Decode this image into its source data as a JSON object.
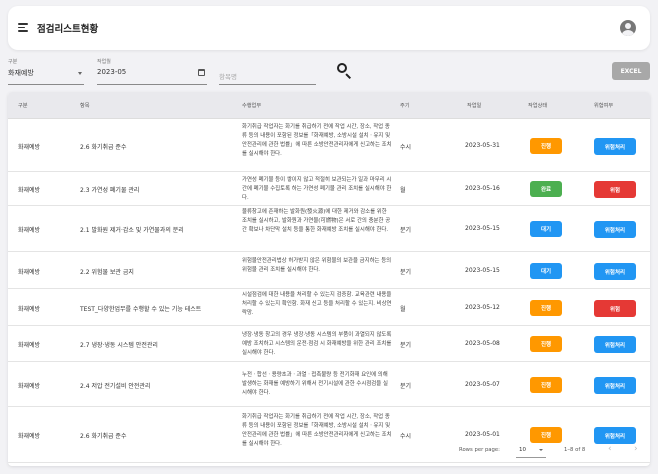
{
  "app": {
    "title": "점검리스트현황"
  },
  "colors": {
    "orange": "#ff9800",
    "green": "#4caf50",
    "blue": "#2196f3",
    "red": "#e53935"
  },
  "filters": {
    "category": {
      "label": "구분",
      "value": "화재예방"
    },
    "date": {
      "label": "작업월",
      "value": "2023-05"
    },
    "item": {
      "placeholder": "항목명"
    },
    "excel_label": "EXCEL"
  },
  "table": {
    "headers": [
      "구분",
      "항목",
      "수행업무",
      "주기",
      "작업일",
      "작업상태",
      "위험여부"
    ],
    "rows": [
      {
        "category": "화재예방",
        "item": "2.6 화기취급 준수",
        "desc": "화기취급 작업자는 화기를 취급하기 전에 작업 시간, 장소, 작업 종류 등의 내용이 포함된 정보를「화재예방, 소방시설 설치ㆍ유지 및 안전관리에 관한 법률」에 따른 소방안전관리자에게 신고하는 조치를 실시해야 한다.",
        "cycle": "수시",
        "date": "2023-05-31",
        "status": "진행",
        "status_color": "orange",
        "risk": "위험처리",
        "risk_color": "blue"
      },
      {
        "category": "화재예방",
        "item": "2.3 가연성 폐기물 관리",
        "desc": "가연성 폐기물 등이 쌓이지 않고 적절히 보관되는가 일과 마무리 시간에 폐기물 수집토록 하는 가연성 폐기물 관리 조치를 실시해야 한다.",
        "cycle": "월",
        "date": "2023-05-16",
        "status": "완료",
        "status_color": "green",
        "risk": "위험",
        "risk_color": "red"
      },
      {
        "category": "화재예방",
        "item": "2.1 발화원 제거·감소 및 가연물과의 분리",
        "desc": "물류창고에 존재하는 발화원(發火源)에 대한 제거와 감소를 위한 조치를 실시하고, 발화원과 가연물(可燃物)은 서로 간의 충분한 공간 확보나 차단막 설치 등을 통한 화재예방 조치를 실시해야 한다.",
        "cycle": "분기",
        "date": "2023-05-15",
        "status": "대기",
        "status_color": "blue",
        "risk": "위험처리",
        "risk_color": "blue"
      },
      {
        "category": "화재예방",
        "item": "2.2 위험물 보관 금지",
        "desc": "위험물안전관리법상 허가받지 않은 위험물의 보관을 금지하는 등의 위험물 관리 조치를 실시해야 한다.",
        "cycle": "분기",
        "date": "2023-05-15",
        "status": "대기",
        "status_color": "blue",
        "risk": "위험처리",
        "risk_color": "blue"
      },
      {
        "category": "화재예방",
        "item": "TEST_다양한업무를 수행할 수 있는 기능 테스트",
        "desc": "시설점검에 대한 내용을 처리할 수 있는지 검증함. 교육관련 내용을처리할 수 있는지 확인함. 화재 신고 등을 처리할 수 있는지. 비상연락망.",
        "cycle": "월",
        "date": "2023-05-12",
        "status": "진행",
        "status_color": "orange",
        "risk": "위험",
        "risk_color": "red"
      },
      {
        "category": "화재예방",
        "item": "2.7 냉장·냉동 시스템 안전관리",
        "desc": "냉장·냉동 창고의 경우 냉장·냉동 시스템의 부품이 과열되지 않도록 예방 조치하고 시스템의 운전·점검 시 화재예방을 위한 관리 조치를 실시해야 한다.",
        "cycle": "분기",
        "date": "2023-05-08",
        "status": "진행",
        "status_color": "orange",
        "risk": "위험처리",
        "risk_color": "blue"
      },
      {
        "category": "화재예방",
        "item": "2.4 저압 전기설비 안전관리",
        "desc": "누전ㆍ합선ㆍ용량초과ㆍ과열ㆍ접촉불량 등 전기화재 요인에 의해 발생하는 화재를 예방하기 위해서 전기시설에 관한 수시점검을 실시해야 한다.",
        "cycle": "분기",
        "date": "2023-05-07",
        "status": "진행",
        "status_color": "orange",
        "risk": "위험처리",
        "risk_color": "blue"
      },
      {
        "category": "화재예방",
        "item": "2.6 화기취급 준수",
        "desc": "화기취급 작업자는 화기를 취급하기 전에 작업 시간, 장소, 작업 종류 등의 내용이 포함된 정보를「화재예방, 소방시설 설치ㆍ유지 및 안전관리에 관한 법률」에 따른 소방안전관리자에게 신고하는 조치를 실시해야 한다.",
        "cycle": "수시",
        "date": "2023-05-01",
        "status": "진행",
        "status_color": "orange",
        "risk": "위험처리",
        "risk_color": "blue"
      }
    ]
  },
  "pagination": {
    "rows_per_page_label": "Rows per page:",
    "rows_per_page": "10",
    "range": "1–8 of 8"
  }
}
